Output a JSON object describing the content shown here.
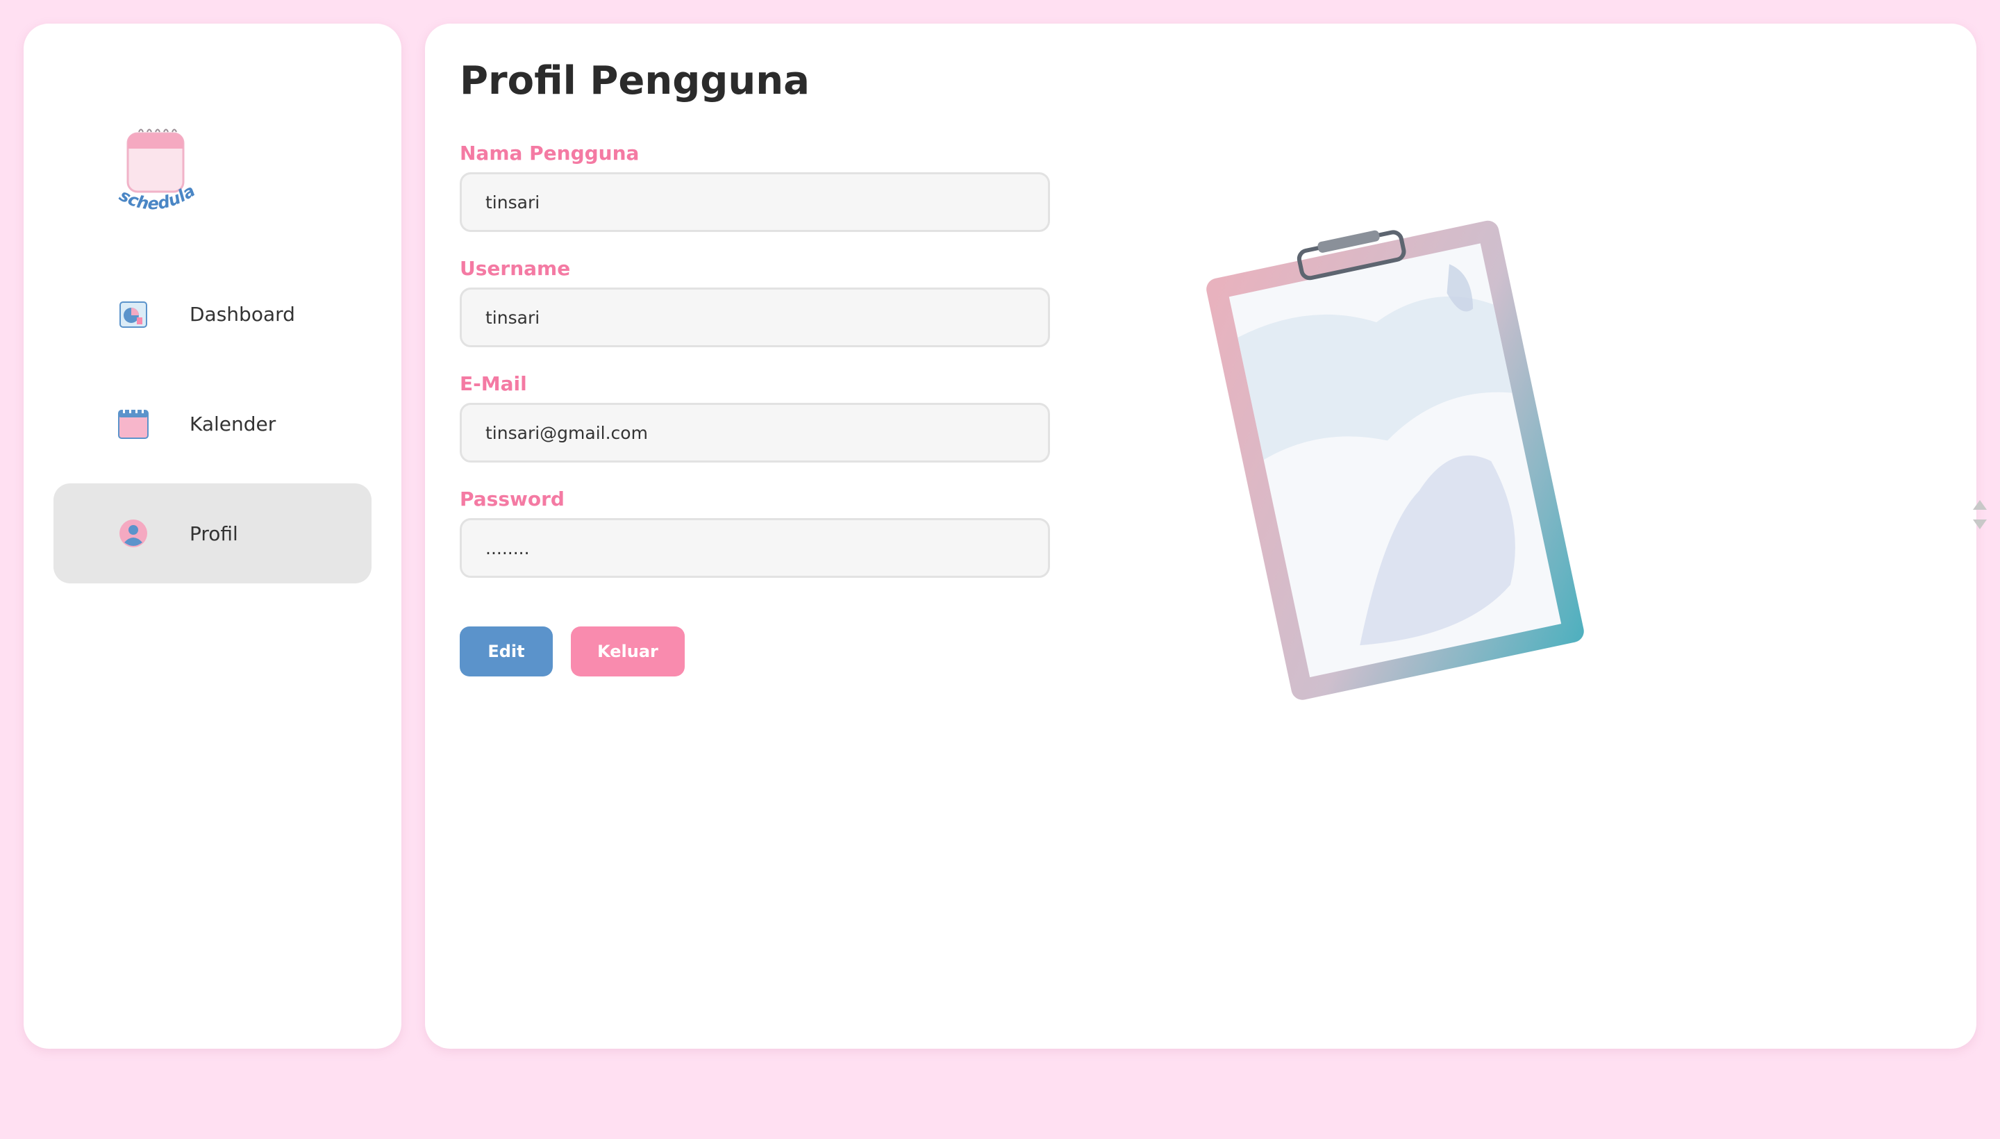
{
  "sidebar": {
    "logo_text": "schedula",
    "items": [
      {
        "label": "Dashboard",
        "icon": "dashboard-icon",
        "active": false
      },
      {
        "label": "Kalender",
        "icon": "calendar-icon",
        "active": false
      },
      {
        "label": "Profil",
        "icon": "user-icon",
        "active": true
      }
    ]
  },
  "main": {
    "title": "Profil Pengguna",
    "fields": [
      {
        "label": "Nama Pengguna",
        "value": "tinsari"
      },
      {
        "label": "Username",
        "value": "tinsari"
      },
      {
        "label": "E-Mail",
        "value": "tinsari@gmail.com"
      },
      {
        "label": "Password",
        "value": "........"
      }
    ],
    "buttons": {
      "edit": "Edit",
      "logout": "Keluar"
    },
    "illustration": "clipboard-illustration"
  },
  "colors": {
    "page_bg": "#ffe0f2",
    "label_pink": "#f47aa3",
    "edit_blue": "#5b93cb",
    "logout_pink": "#f98bae",
    "active_item_bg": "#e6e6e6"
  }
}
